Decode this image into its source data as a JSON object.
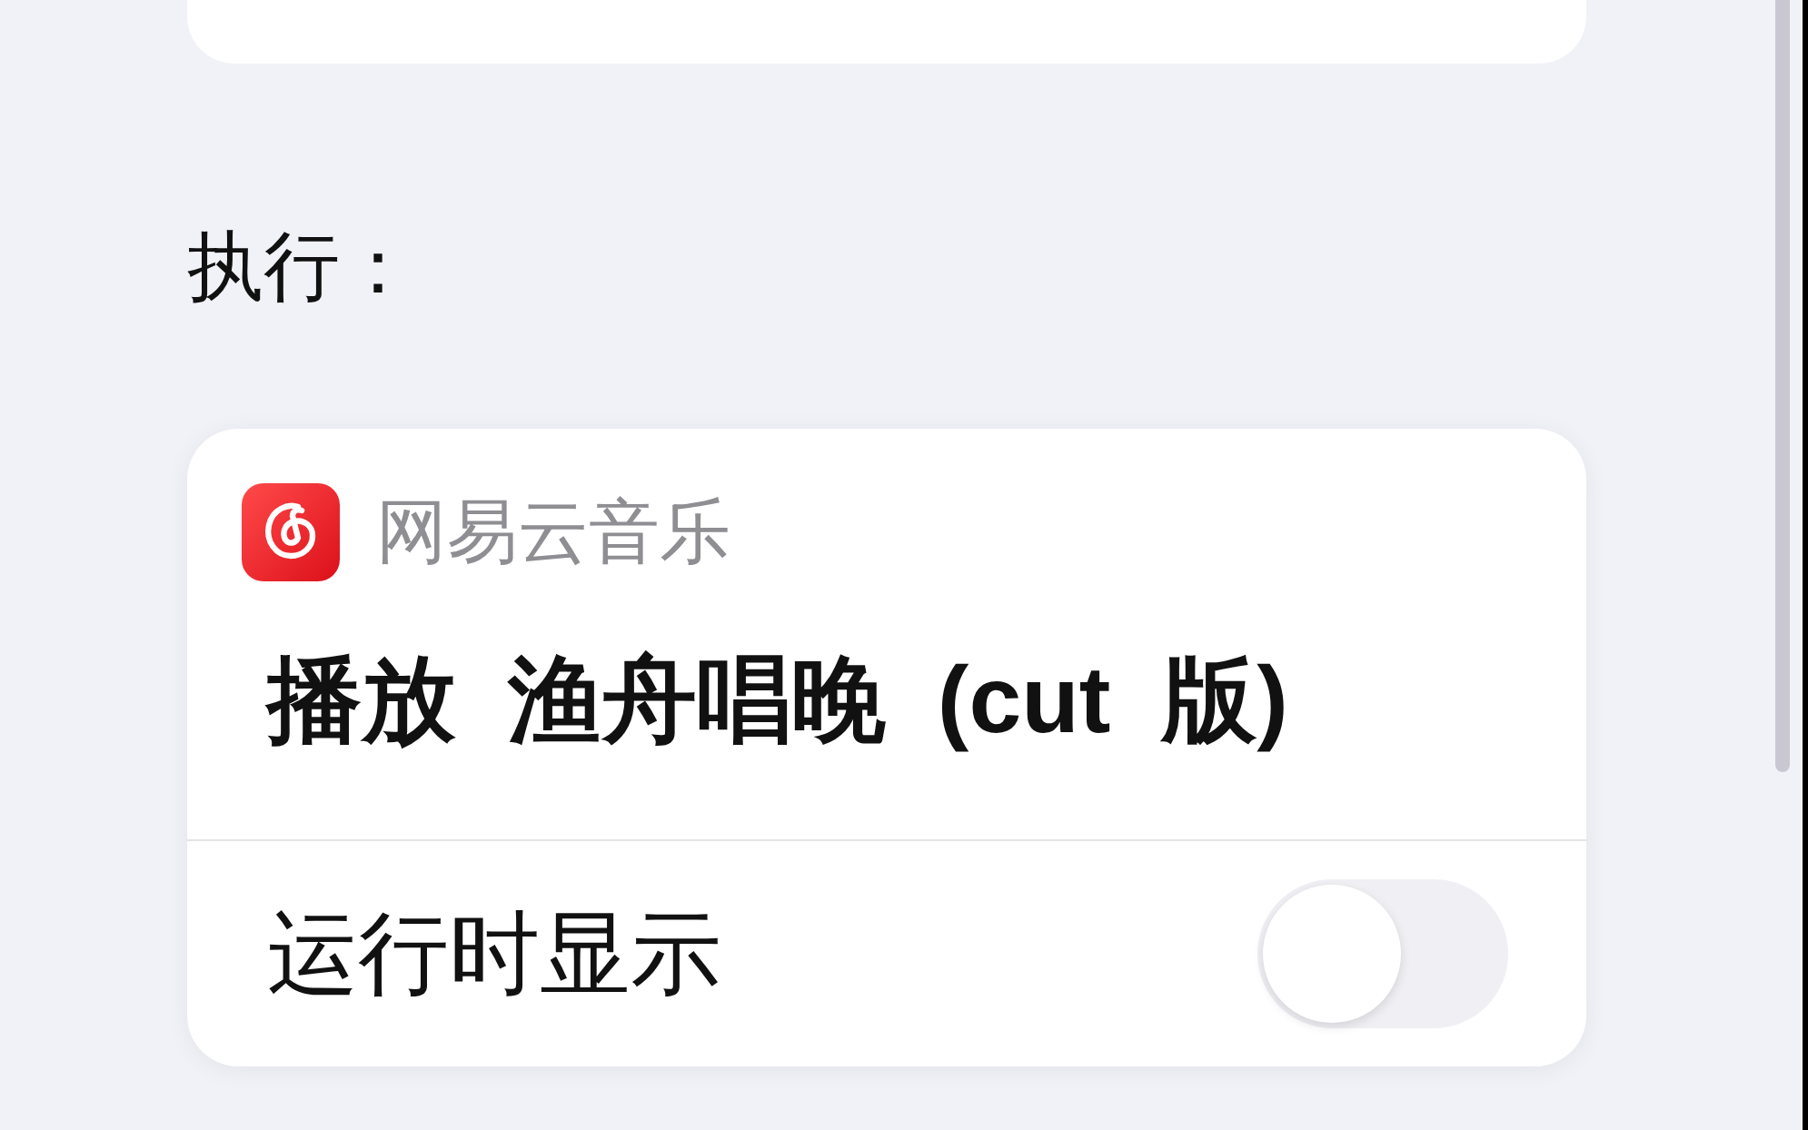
{
  "section_heading": "执行：",
  "action": {
    "app_name": "网易云音乐",
    "title": "播放 渔舟唱晚 (cut 版)",
    "options": [
      {
        "kind": "toggle",
        "label": "运行时显示",
        "on": false
      }
    ]
  }
}
